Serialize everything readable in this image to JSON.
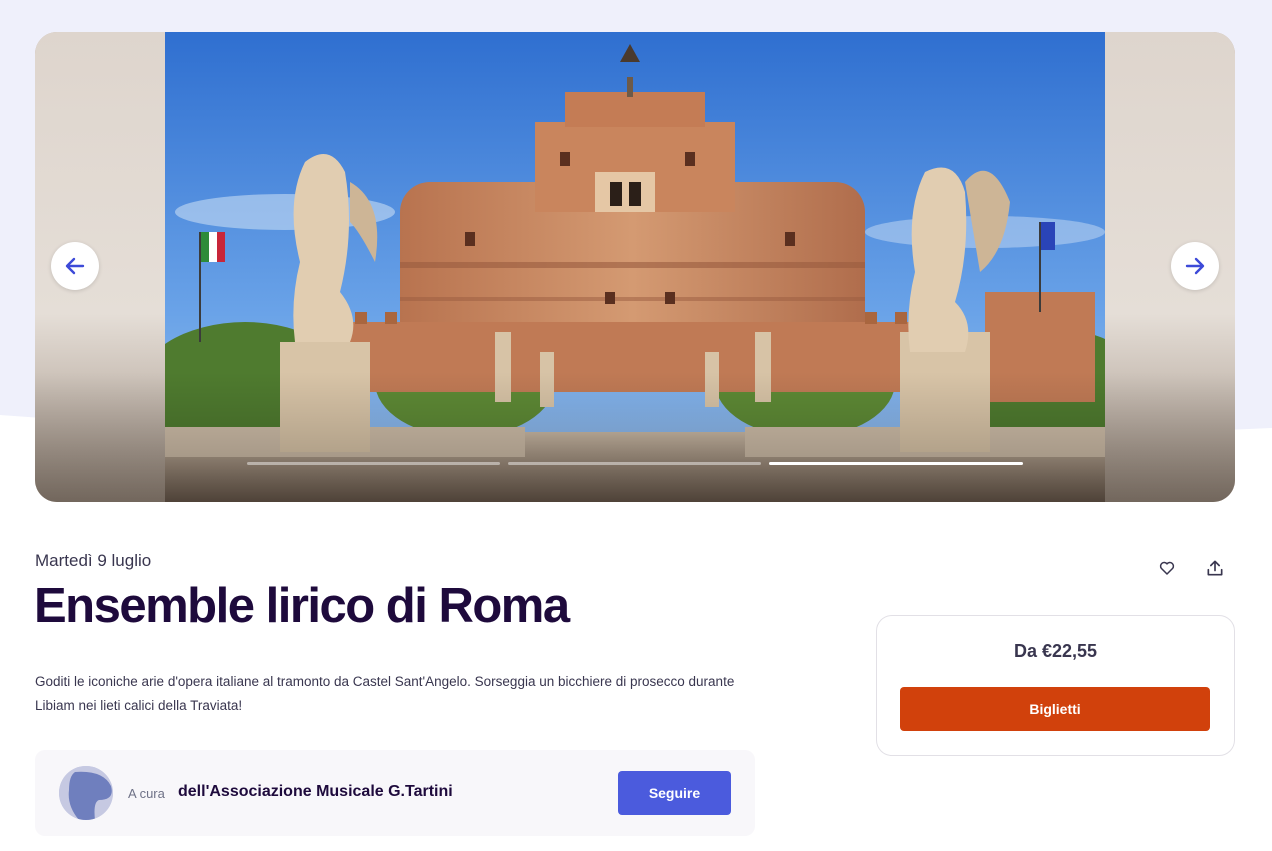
{
  "event": {
    "date": "Martedì 9 luglio",
    "title": "Ensemble lirico di Roma",
    "summary": "Goditi le iconiche arie d'opera italiane al tramonto da Castel Sant'Angelo. Sorseggia un bicchiere di prosecco durante Libiam nei lieti calici della Traviata!"
  },
  "carousel": {
    "image_alt": "Castel Sant'Angelo",
    "slides_total": 3,
    "active_slide": 3,
    "prev_icon": "arrow-left-icon",
    "next_icon": "arrow-right-icon"
  },
  "organizer": {
    "prefix": "A cura",
    "name": "dell'Associazione Musicale G.Tartini",
    "follow_label": "Seguire"
  },
  "actions": {
    "like_icon": "heart-icon",
    "share_icon": "share-icon"
  },
  "tickets": {
    "price_label": "Da €22,55",
    "button_label": "Biglietti"
  },
  "colors": {
    "accent": "#4b5bdd",
    "cta": "#d1410c",
    "title": "#1e0a3c",
    "page_band": "#eff0fb"
  }
}
